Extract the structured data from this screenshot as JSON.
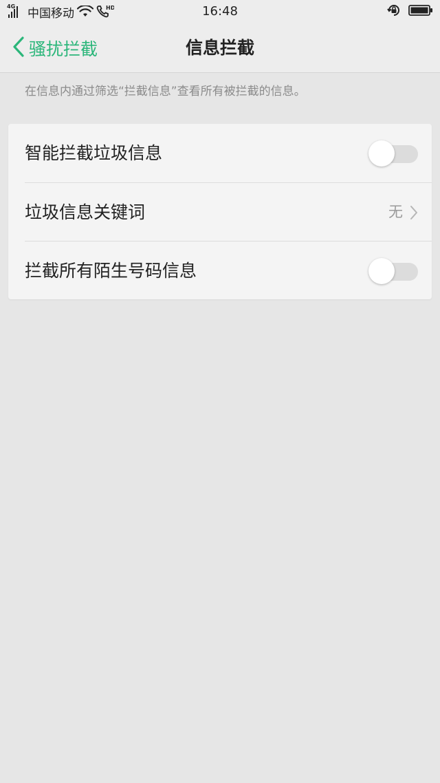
{
  "status_bar": {
    "network_type": "4G",
    "carrier": "中国移动",
    "call_badge": "HD",
    "time": "16:48",
    "icons": [
      "signal-icon",
      "wifi-icon",
      "hd-call-icon",
      "rotation-lock-icon",
      "battery-icon"
    ]
  },
  "nav": {
    "back_label": "骚扰拦截",
    "title": "信息拦截",
    "accent_color": "#2bb67a"
  },
  "description": "在信息内通过筛选“拦截信息”查看所有被拦截的信息。",
  "settings": [
    {
      "label": "智能拦截垃圾信息",
      "type": "toggle",
      "enabled": false
    },
    {
      "label": "垃圾信息关键词",
      "type": "link",
      "value": "无"
    },
    {
      "label": "拦截所有陌生号码信息",
      "type": "toggle",
      "enabled": false
    }
  ]
}
